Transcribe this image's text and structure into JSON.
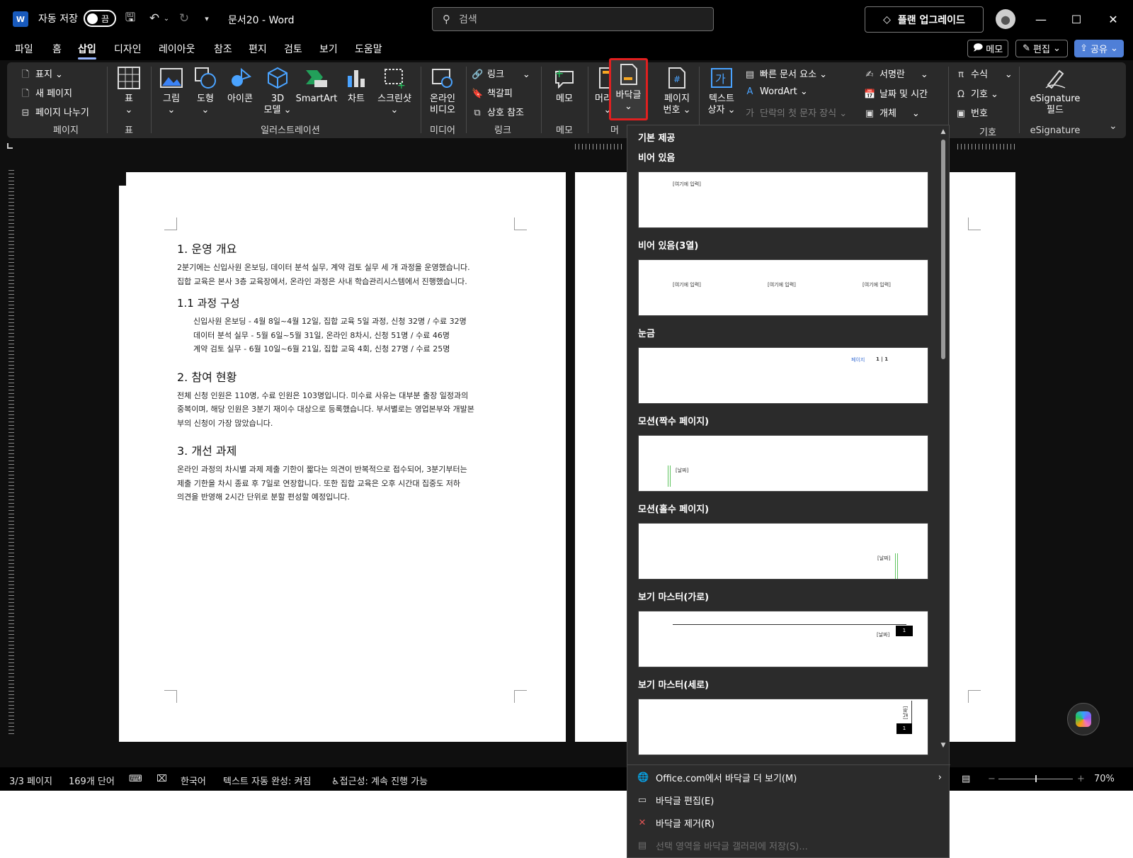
{
  "titlebar": {
    "autosave_label": "자동 저장",
    "autosave_state": "끔",
    "doc_title": "문서20  -  Word",
    "search_placeholder": "검색",
    "upgrade_label": "플랜 업그레이드"
  },
  "tabs": [
    "파일",
    "홈",
    "삽입",
    "디자인",
    "레이아웃",
    "참조",
    "편지",
    "검토",
    "보기",
    "도움말"
  ],
  "active_tab": "삽입",
  "tab_buttons": {
    "memo": "메모",
    "edit": "편집",
    "share": "공유"
  },
  "ribbon": {
    "pages": {
      "cover": "표지",
      "new_page": "새 페이지",
      "page_break": "페이지 나누기",
      "group": "페이지"
    },
    "table": {
      "label": "표",
      "group": "표"
    },
    "illustrations": {
      "picture": "그림",
      "shapes": "도형",
      "icons": "아이콘",
      "model_3d_line1": "3D",
      "model_3d_line2": "모델",
      "smartart": "SmartArt",
      "chart": "차트",
      "screenshot": "스크린샷",
      "group": "일러스트레이션"
    },
    "media": {
      "online_video_line1": "온라인",
      "online_video_line2": "비디오",
      "group": "미디어"
    },
    "links": {
      "link": "링크",
      "bookmark": "책갈피",
      "cross_ref": "상호 참조",
      "group": "링크"
    },
    "comments": {
      "memo": "메모",
      "group": "메모"
    },
    "header_footer": {
      "header": "머리글",
      "footer": "바닥글",
      "page_number_line1": "페이지",
      "page_number_line2": "번호",
      "group_partial": "머"
    },
    "text": {
      "textbox_line1": "텍스트",
      "textbox_line2": "상자",
      "quick_parts": "빠른 문서 요소",
      "wordart": "WordArt",
      "drop_cap": "단락의 첫 문자 장식",
      "signature_line": "서명란",
      "date_time": "날짜 및 시간",
      "object": "개체"
    },
    "symbols": {
      "equation": "수식",
      "symbol": "기호",
      "number": "번호",
      "group": "기호"
    },
    "esignature": {
      "field_line1": "eSignature",
      "field_line2": "필드",
      "group": "eSignature"
    }
  },
  "document": {
    "h1_1": "1. 운영 개요",
    "p1_line1": "2분기에는 신입사원 온보딩, 데이터 분석 실무, 계약 검토 실무 세 개 과정을 운영했습니다.",
    "p1_line2": "집합 교육은 본사 3층 교육장에서, 온라인 과정은 사내 학습관리시스템에서 진행했습니다.",
    "h2_1": "1.1 과정 구성",
    "list": [
      "신입사원 온보딩 - 4월 8일~4월 12일, 집합 교육 5일 과정, 신청 32명 / 수료 32명",
      "데이터 분석 실무 - 5월 6일~5월 31일, 온라인 8차시, 신청 51명 / 수료 46명",
      "계약 검토 실무 - 6월 10일~6월 21일, 집합 교육 4회, 신청 27명 / 수료 25명"
    ],
    "h1_2": "2. 참여 현황",
    "p2_line1": "전체 신청 인원은 110명, 수료 인원은 103명입니다. 미수료 사유는 대부분 출장 일정과의",
    "p2_line2": "중복이며, 해당 인원은 3분기 재이수 대상으로 등록했습니다. 부서별로는 영업본부와 개발본",
    "p2_line3": "부의 신청이 가장 많았습니다.",
    "h1_3": "3. 개선 과제",
    "p3_line1": "온라인 과정의 차시별 과제 제출 기한이 짧다는 의견이 반복적으로 접수되어, 3분기부터는",
    "p3_line2": "제출 기한을 차시 종료 후 7일로 연장합니다. 또한 집합 교육은 오후 시간대 집중도 저하",
    "p3_line3": "의견을 반영해 2시간 단위로 분할 편성할 예정입니다."
  },
  "gallery": {
    "header": "기본 제공",
    "items": [
      {
        "label": "비어 있음",
        "placeholder": "[여기에 입력]"
      },
      {
        "label": "비어 있음(3열)",
        "placeholder": "[여기에 입력]"
      },
      {
        "label": "눈금",
        "page_text": "페이지",
        "page_num": "1 | 1"
      },
      {
        "label": "모션(짝수 페이지)",
        "date": "[날짜]"
      },
      {
        "label": "모션(홀수 페이지)",
        "date": "[날짜]"
      },
      {
        "label": "보기 마스터(가로)",
        "date": "[날짜]",
        "num": "1"
      },
      {
        "label": "보기 마스터(세로)",
        "date": "[날짜]",
        "num": "1"
      }
    ],
    "menu": [
      {
        "label": "Office.com에서 바닥글 더 보기(M)",
        "enabled": true
      },
      {
        "label": "바닥글 편집(E)",
        "enabled": true
      },
      {
        "label": "바닥글 제거(R)",
        "enabled": true
      },
      {
        "label": "선택 영역을 바닥글 갤러리에 저장(S)...",
        "enabled": false
      }
    ]
  },
  "statusbar": {
    "page": "3/3 페이지",
    "words": "169개 단어",
    "language": "한국어",
    "autocomplete": "텍스트 자동 완성: 켜짐",
    "accessibility": "접근성: 계속 진행 가능",
    "zoom": "70%"
  },
  "colors": {
    "ribbon_bg": "#2a2a2a",
    "accent_share": "#4f7fd7",
    "highlight": "#e02020",
    "gallery_green": "#5fc45f"
  }
}
